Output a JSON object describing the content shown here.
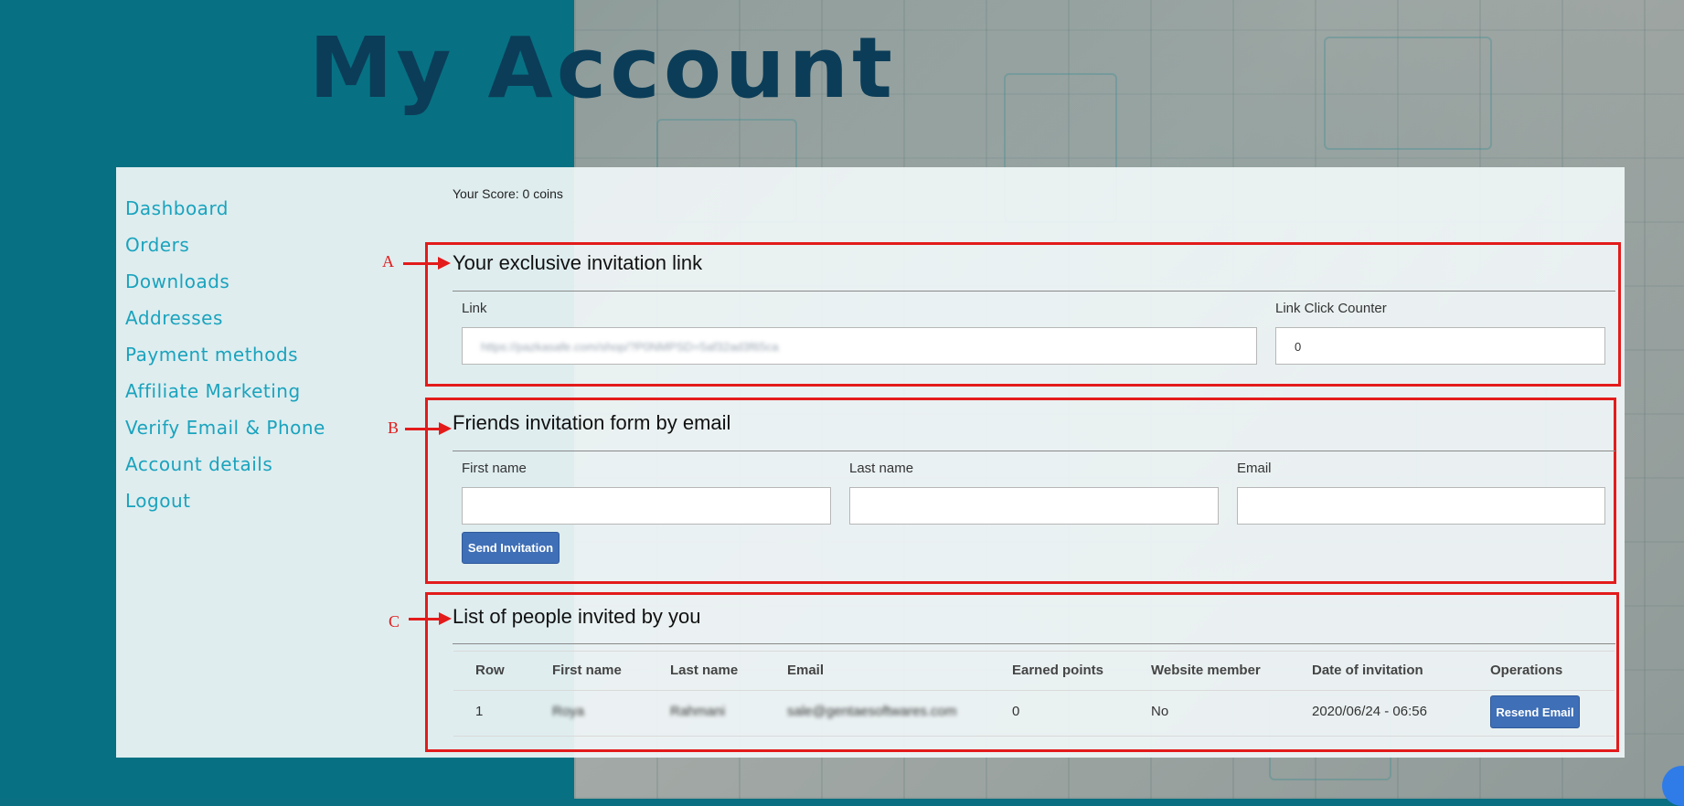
{
  "page_title": "My Account",
  "sidebar": {
    "items": [
      {
        "label": "Dashboard"
      },
      {
        "label": "Orders"
      },
      {
        "label": "Downloads"
      },
      {
        "label": "Addresses"
      },
      {
        "label": "Payment methods"
      },
      {
        "label": "Affiliate Marketing"
      },
      {
        "label": "Verify Email & Phone"
      },
      {
        "label": "Account details"
      },
      {
        "label": "Logout"
      }
    ]
  },
  "score_text": "Your Score: 0 coins",
  "annotations": [
    "A",
    "B",
    "C"
  ],
  "invitation_link": {
    "title": "Your exclusive invitation link",
    "link_label": "Link",
    "link_value": "https://pazkasafe.com/shop/?P0NMPSD=5af32ad3f65ca",
    "counter_label": "Link Click Counter",
    "counter_value": "0"
  },
  "invite_form": {
    "title": "Friends invitation form by email",
    "first_name_label": "First name",
    "last_name_label": "Last name",
    "email_label": "Email",
    "first_name_value": "",
    "last_name_value": "",
    "email_value": "",
    "send_button": "Send Invitation"
  },
  "invited_list": {
    "title": "List of people invited by you",
    "columns": [
      "Row",
      "First name",
      "Last name",
      "Email",
      "Earned points",
      "Website member",
      "Date of invitation",
      "Operations"
    ],
    "rows": [
      {
        "row": "1",
        "first_name": "Roya",
        "last_name": "Rahmani",
        "email": "sale@gentaesoftwares.com",
        "earned_points": "0",
        "website_member": "No",
        "date": "2020/06/24 - 06:56",
        "operation": "Resend Email"
      }
    ]
  },
  "colors": {
    "accent_link": "#1aa3bd",
    "title": "#0b3d58",
    "annotation_red": "#e31b1b",
    "button_blue": "#3f6fb6"
  }
}
